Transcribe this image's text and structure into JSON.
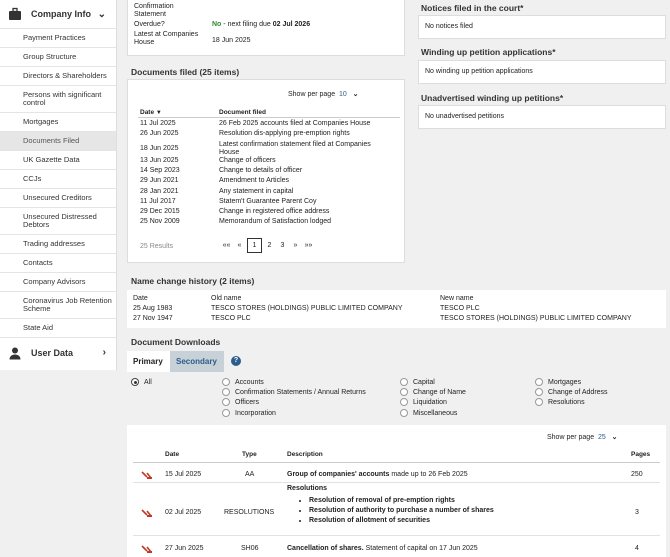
{
  "sidebar": {
    "company_info": "Company Info",
    "items": [
      "Payment Practices",
      "Group Structure",
      "Directors & Shareholders",
      "Persons with significant control",
      "Mortgages",
      "Documents Filed",
      "UK Gazette Data",
      "CCJs",
      "Unsecured Creditors",
      "Unsecured Distressed Debtors",
      "Trading addresses",
      "Contacts",
      "Company Advisors",
      "Coronavirus Job Retention Scheme",
      "State Aid"
    ],
    "user_data": "User Data"
  },
  "confirmation": {
    "label": "Confirmation Statement",
    "overdue_label": "Overdue?",
    "overdue_no": "No",
    "overdue_text": " - next filing due ",
    "overdue_date": "02 Jul 2026",
    "latest_label": "Latest at Companies House",
    "latest_date": "18 Jun 2025"
  },
  "docs": {
    "title": "Documents filed (25 items)",
    "show_per_page": "Show per page",
    "per_page": "10",
    "col_date": "Date",
    "col_doc": "Document filed",
    "rows": [
      [
        "11 Jul 2025",
        "26 Feb 2025 accounts filed at Companies House"
      ],
      [
        "26 Jun 2025",
        "Resolution dis-applying pre-emption rights"
      ],
      [
        "18 Jun 2025",
        "Latest confirmation statement filed at Companies House"
      ],
      [
        "13 Jun 2025",
        "Change of officers"
      ],
      [
        "14 Sep 2023",
        "Change to details of officer"
      ],
      [
        "29 Jun 2021",
        "Amendment to Articles"
      ],
      [
        "28 Jan 2021",
        "Any statement in capital"
      ],
      [
        "11 Jul 2017",
        "Statem't Guarantee Parent Coy"
      ],
      [
        "29 Dec 2015",
        "Change in registered office address"
      ],
      [
        "25 Nov 2009",
        "Memorandum of Satisfaction lodged"
      ]
    ],
    "results": "25 Results",
    "pages": [
      "««",
      "«",
      "1",
      "2",
      "3",
      "»",
      "»»"
    ]
  },
  "notices": {
    "court_title": "Notices filed in the court*",
    "court_text": "No notices filed",
    "winding_title": "Winding up petition applications*",
    "winding_text": "No winding up petition applications",
    "unadv_title": "Unadvertised winding up petitions*",
    "unadv_text": "No unadvertised petitions"
  },
  "names": {
    "title": "Name change history (2 items)",
    "col_date": "Date",
    "col_old": "Old name",
    "col_new": "New name",
    "rows": [
      [
        "25 Aug 1983",
        "TESCO STORES (HOLDINGS) PUBLIC LIMITED COMPANY",
        "TESCO PLC"
      ],
      [
        "27 Nov 1947",
        "TESCO PLC",
        "TESCO STORES (HOLDINGS) PUBLIC LIMITED COMPANY"
      ]
    ]
  },
  "downloads": {
    "title": "Document Downloads",
    "tab_primary": "Primary",
    "tab_secondary": "Secondary",
    "help": "?",
    "all": "All",
    "filters": [
      "Accounts",
      "Confirmation Statements / Annual Returns",
      "Officers",
      "Incorporation",
      "Capital",
      "Change of Name",
      "Liquidation",
      "Miscellaneous",
      "Mortgages",
      "Change of Address",
      "Resolutions"
    ],
    "show_per_page": "Show per page",
    "per_page": "25",
    "col_date": "Date",
    "col_type": "Type",
    "col_desc": "Description",
    "col_pages": "Pages",
    "rows": [
      {
        "date": "15 Jul 2025",
        "type": "AA",
        "desc_bold": "Group of companies' accounts",
        "desc": " made up to 26 Feb 2025",
        "pages": "250"
      },
      {
        "date": "02 Jul 2025",
        "type": "RESOLUTIONS",
        "desc_bold": "Resolutions",
        "bullets": [
          "Resolution of removal of pre-emption rights",
          "Resolution of authority to purchase a number of shares",
          "Resolution of allotment of securities"
        ],
        "pages": "3"
      },
      {
        "date": "27 Jun 2025",
        "type": "SH06",
        "desc_bold": "Cancellation of shares.",
        "desc": " Statement of capital on 17 Jun 2025",
        "pages": "4"
      }
    ]
  },
  "colors": {
    "accent": "#2b5d8a",
    "pdf": "#c0392b"
  }
}
